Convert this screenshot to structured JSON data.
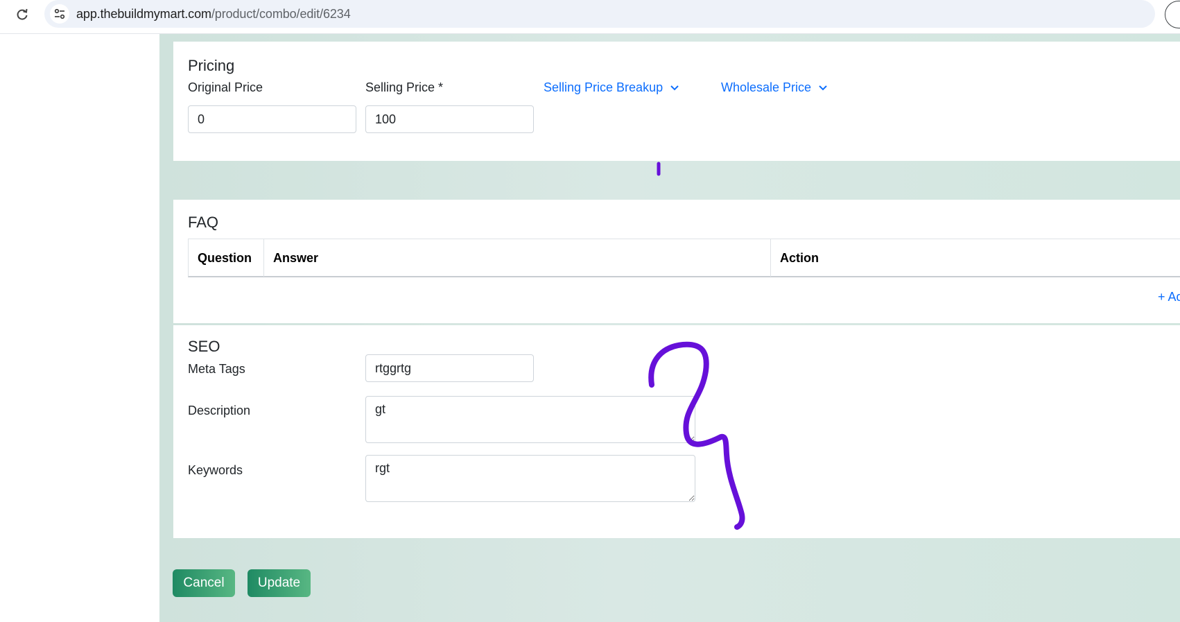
{
  "browser": {
    "url_host": "app.thebuildmymart.com",
    "url_path": "/product/combo/edit/6234",
    "reload_icon": "reload-icon",
    "site_info_icon": "site-info-icon"
  },
  "pricing": {
    "title": "Pricing",
    "original_price_label": "Original Price",
    "original_price_value": "0",
    "selling_price_label": "Selling Price *",
    "selling_price_value": "100",
    "breakup_link": "Selling Price Breakup",
    "wholesale_link": "Wholesale Price"
  },
  "faq": {
    "title": "FAQ",
    "columns": [
      "Question",
      "Answer",
      "Action"
    ],
    "add_link": "+ Ad"
  },
  "seo": {
    "title": "SEO",
    "meta_tags_label": "Meta Tags",
    "meta_tags_value": "rtggrtg",
    "description_label": "Description",
    "description_value": "gt",
    "keywords_label": "Keywords",
    "keywords_value": "rgt"
  },
  "actions": {
    "cancel_label": "Cancel",
    "update_label": "Update"
  },
  "colors": {
    "link": "#0d6efd",
    "button_start": "#1f8a63",
    "button_end": "#58b783",
    "annotation": "#6610d9",
    "background_tint": "#d2e6df"
  }
}
